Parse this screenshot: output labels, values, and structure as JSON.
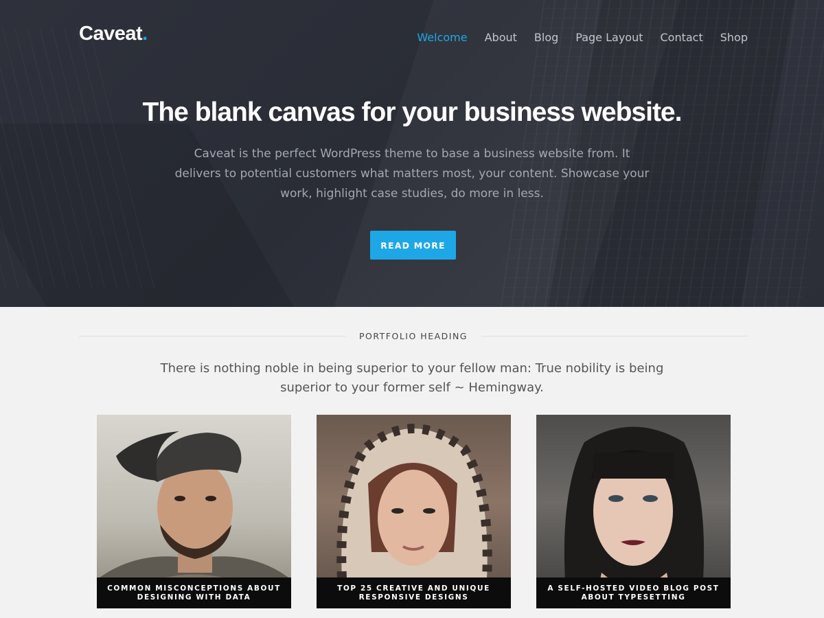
{
  "site": {
    "logo_text": "Caveat",
    "logo_dot": "."
  },
  "nav": {
    "items": [
      {
        "label": "Welcome",
        "active": true
      },
      {
        "label": "About"
      },
      {
        "label": "Blog"
      },
      {
        "label": "Page Layout"
      },
      {
        "label": "Contact"
      },
      {
        "label": "Shop"
      }
    ]
  },
  "hero": {
    "title": "The blank canvas for your business website.",
    "text": "Caveat is the perfect WordPress theme to base a business website from. It delivers to potential customers what matters most, your content. Showcase your work, highlight case studies, do more in less.",
    "button": "READ MORE"
  },
  "portfolio": {
    "heading": "PORTFOLIO HEADING",
    "quote": "There is nothing noble in being superior to your fellow man: True nobility is being superior to your former self ~ Hemingway.",
    "items": [
      {
        "caption": "COMMON MISCONCEPTIONS ABOUT DESIGNING WITH DATA"
      },
      {
        "caption": "TOP 25 CREATIVE AND UNIQUE RESPONSIVE DESIGNS"
      },
      {
        "caption": "A SELF-HOSTED VIDEO BLOG POST ABOUT TYPESETTING"
      }
    ]
  },
  "colors": {
    "accent": "#1ea7e6",
    "hero_bg": "#2c2f38",
    "page_bg": "#f2f2f2"
  }
}
